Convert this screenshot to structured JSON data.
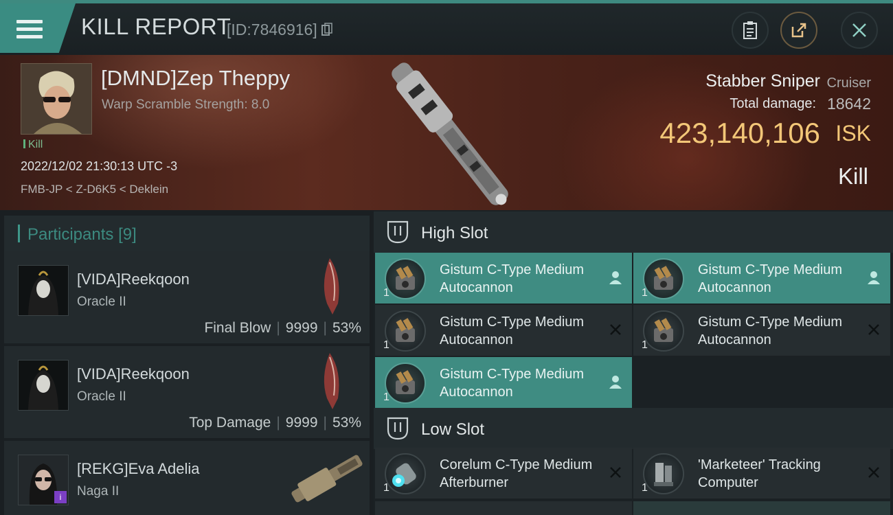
{
  "header": {
    "title": "KILL REPORT",
    "id_text": "[ID:7846916]",
    "buttons": [
      "clipboard",
      "share",
      "close"
    ]
  },
  "victim": {
    "name": "[DMND]Zep Theppy",
    "warp_scramble": "Warp Scramble Strength: 8.0",
    "kill_tag": "Kill",
    "datetime": "2022/12/02 21:30:13 UTC -3",
    "location": "FMB-JP < Z-D6K5 < Deklein",
    "ship_name": "Stabber Sniper",
    "ship_class": "Cruiser",
    "total_damage_label": "Total damage:",
    "total_damage": "18642",
    "isk_value": "423,140,106",
    "isk_unit": "ISK",
    "result": "Kill"
  },
  "participants": {
    "title": "Participants",
    "count": "[9]",
    "rows": [
      {
        "name": "[VIDA]Reekqoon",
        "ship": "Oracle II",
        "label": "Final Blow",
        "damage": "9999",
        "percent": "53%"
      },
      {
        "name": "[VIDA]Reekqoon",
        "ship": "Oracle II",
        "label": "Top Damage",
        "damage": "9999",
        "percent": "53%"
      },
      {
        "name": "[REKG]Eva Adelia",
        "ship": "Naga II",
        "label": "",
        "damage": "",
        "percent": ""
      }
    ]
  },
  "slots": {
    "high": {
      "title": "High Slot",
      "modules": [
        {
          "name": "Gistum C-Type Medium Autocannon",
          "qty": "1",
          "state": "selected"
        },
        {
          "name": "Gistum C-Type Medium Autocannon",
          "qty": "1",
          "state": "selected"
        },
        {
          "name": "Gistum C-Type Medium Autocannon",
          "qty": "1",
          "state": "destroyed"
        },
        {
          "name": "Gistum C-Type Medium Autocannon",
          "qty": "1",
          "state": "destroyed"
        },
        {
          "name": "Gistum C-Type Medium Autocannon",
          "qty": "1",
          "state": "selected"
        }
      ]
    },
    "low": {
      "title": "Low Slot",
      "modules": [
        {
          "name": "Corelum C-Type Medium Afterburner",
          "qty": "1",
          "state": "destroyed"
        },
        {
          "name": "'Marketeer' Tracking Computer",
          "qty": "1",
          "state": "destroyed"
        }
      ]
    }
  },
  "colors": {
    "accent": "#3f8c82",
    "isk": "#f3c778",
    "kill_tag": "#7dbb8e"
  }
}
